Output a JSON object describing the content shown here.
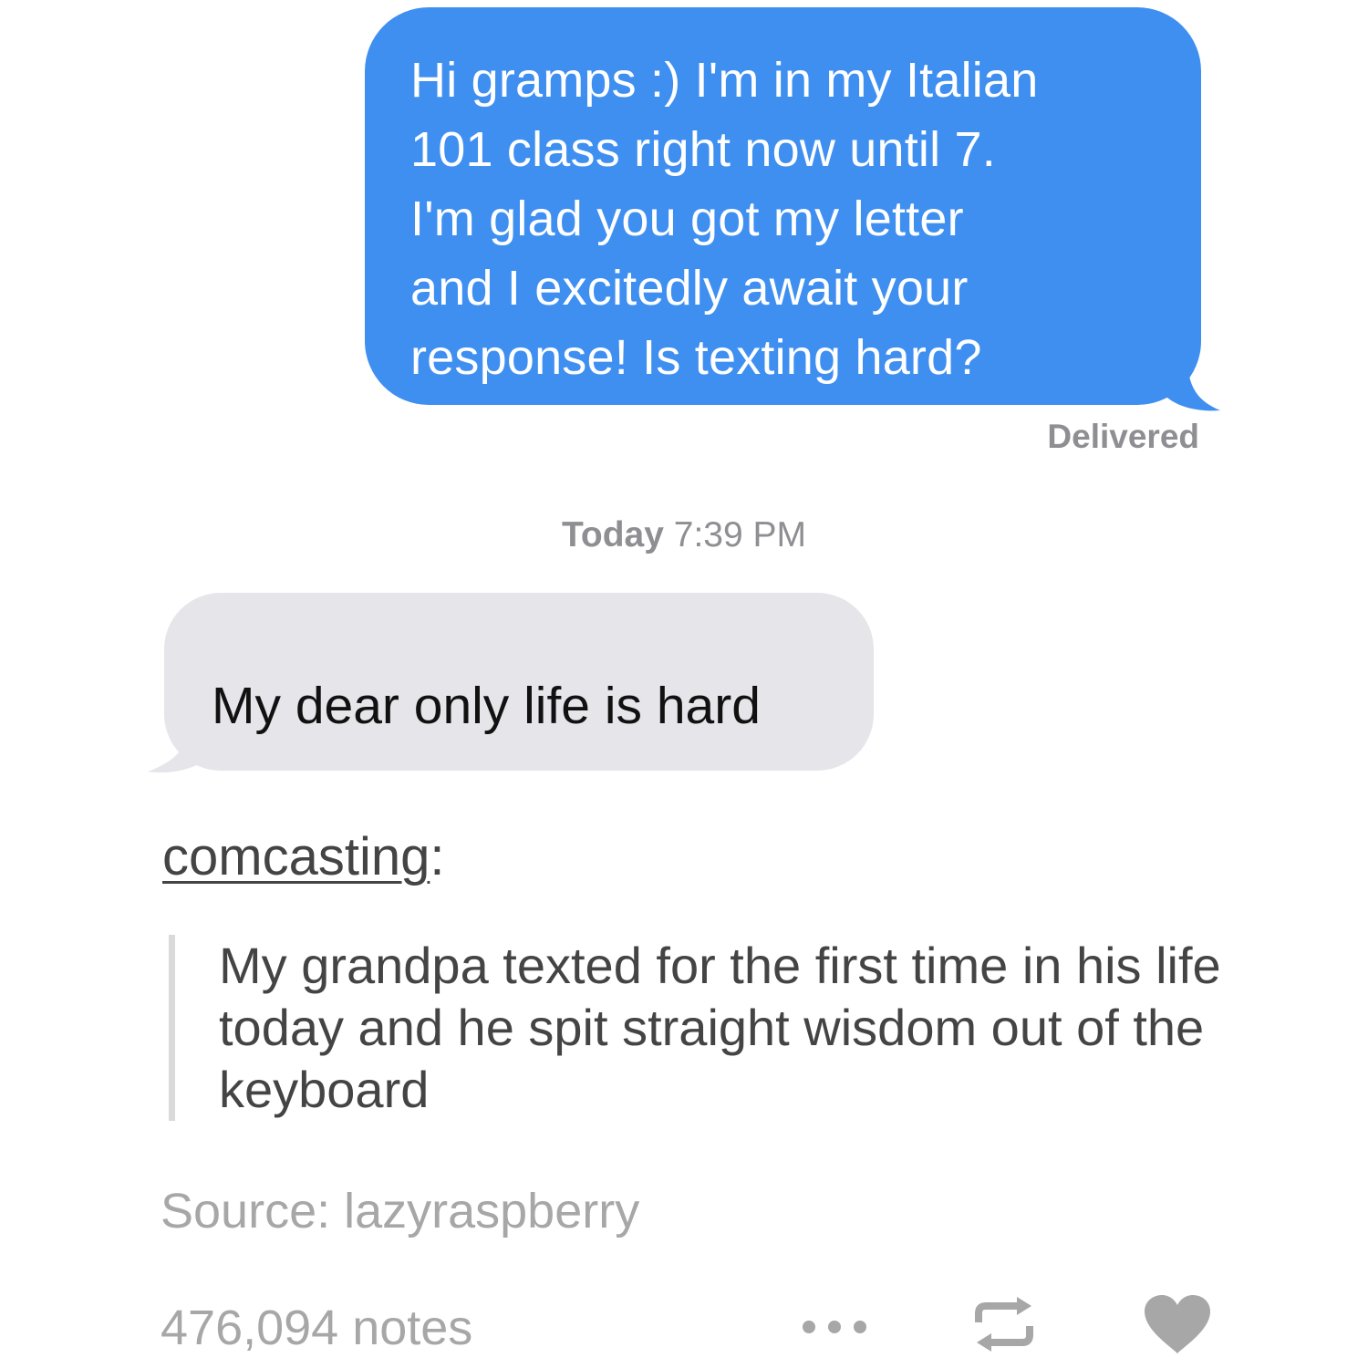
{
  "sent_message": {
    "lines": [
      "Hi gramps :) I'm in my Italian",
      "101 class right now until 7.",
      "I'm glad you got my letter",
      "and I excitedly await your",
      "response! Is texting hard?"
    ],
    "status": "Delivered"
  },
  "timestamp": {
    "day": "Today",
    "time": "7:39 PM"
  },
  "received_message": {
    "text": "My dear only life is hard"
  },
  "post": {
    "username": "comcasting",
    "username_suffix": ":",
    "quote": "My grandpa texted for the first time in his life today and he spit straight wisdom out of the keyboard",
    "source_label": "Source: ",
    "source_name": "lazyraspberry",
    "notes": "476,094 notes"
  },
  "icons": {
    "more": "more-options-icon",
    "reblog": "reblog-icon",
    "like": "heart-icon"
  },
  "colors": {
    "sent_bubble": "#3f8ff1",
    "received_bubble": "#e5e5ea",
    "meta_gray": "#8e8e93",
    "post_text": "#444444",
    "muted_text": "#a7a7a7"
  }
}
